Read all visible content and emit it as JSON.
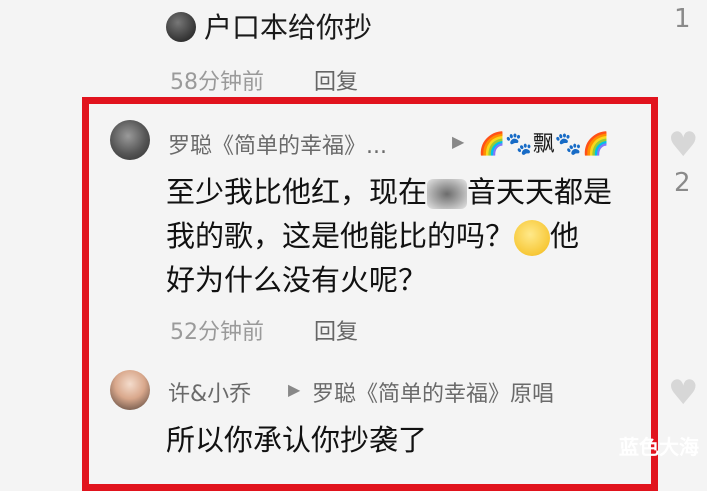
{
  "top_comment": {
    "text": "户口本给你抄",
    "time": "58分钟前",
    "reply": "回复",
    "like_count": "1"
  },
  "highlighted_comment": {
    "username": "罗聪《简单的幸福》...",
    "badges": "🌈🐾飘🐾🌈",
    "line1_before": "至少我比他红，现在",
    "line1_after": "音天天都是",
    "line2": "我的歌，这是他能比的吗？",
    "line2_after": "他",
    "line3": "好为什么没有火呢？",
    "time": "52分钟前",
    "reply": "回复",
    "like_count": "2"
  },
  "reply_comment": {
    "username": "许&小乔",
    "reply_to": "罗聪《简单的幸福》原唱",
    "text": "所以你承认你抄袭了"
  },
  "watermark": "蓝色大海",
  "colors": {
    "frame": "#e1131d",
    "background": "#f4f4f4"
  }
}
